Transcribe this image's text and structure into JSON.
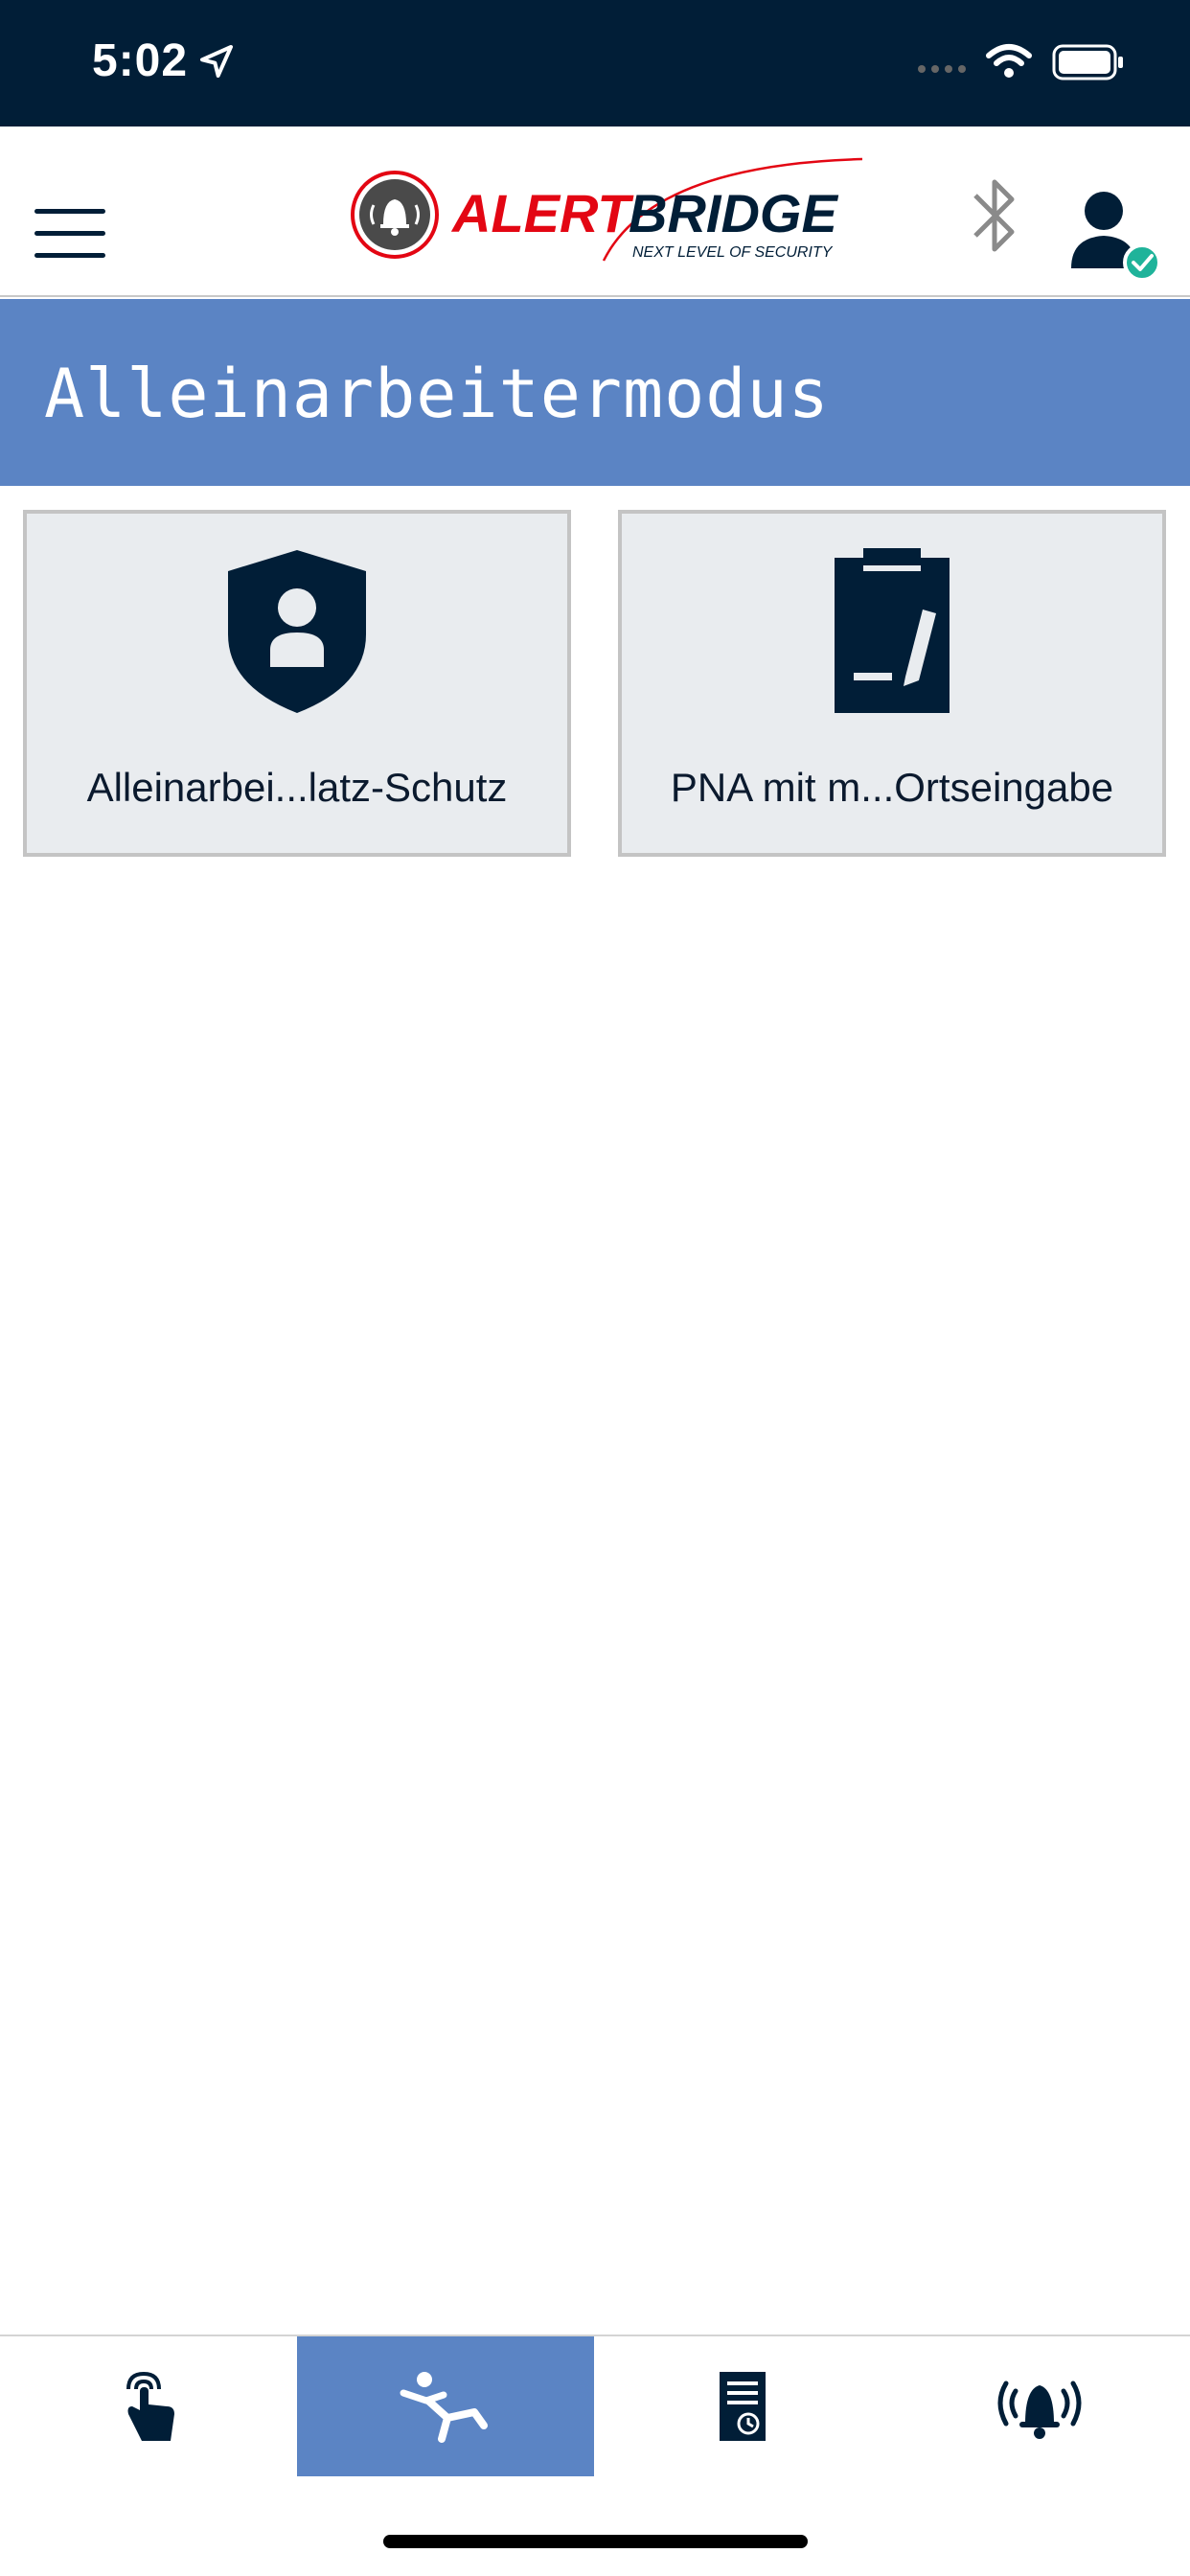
{
  "status_bar": {
    "time": "5:02",
    "icons": [
      "location-arrow-icon",
      "signal-icon",
      "wifi-icon",
      "battery-icon"
    ]
  },
  "header": {
    "logo_text": "ALERTBRIDGE",
    "logo_tagline": "NEXT LEVEL OF SECURITY",
    "icons": [
      "menu-icon",
      "bluetooth-icon",
      "user-connected-icon"
    ]
  },
  "page": {
    "title": "Alleinarbeitermodus"
  },
  "tiles": [
    {
      "label": "Alleinarbei...latz-Schutz",
      "icon": "shield-person-icon"
    },
    {
      "label": "PNA mit m...Ortseingabe",
      "icon": "clipboard-edit-icon"
    }
  ],
  "bottom_nav": {
    "items": [
      {
        "icon": "touch-icon",
        "active": false
      },
      {
        "icon": "falling-person-icon",
        "active": true
      },
      {
        "icon": "document-clock-icon",
        "active": false
      },
      {
        "icon": "alarm-bell-icon",
        "active": false
      }
    ]
  },
  "colors": {
    "status_bar": "#011e37",
    "accent": "#5b84c4",
    "brand_red": "#e30613",
    "dark": "#011e37",
    "tile_bg": "#e9ecef",
    "success": "#1fb39a"
  }
}
